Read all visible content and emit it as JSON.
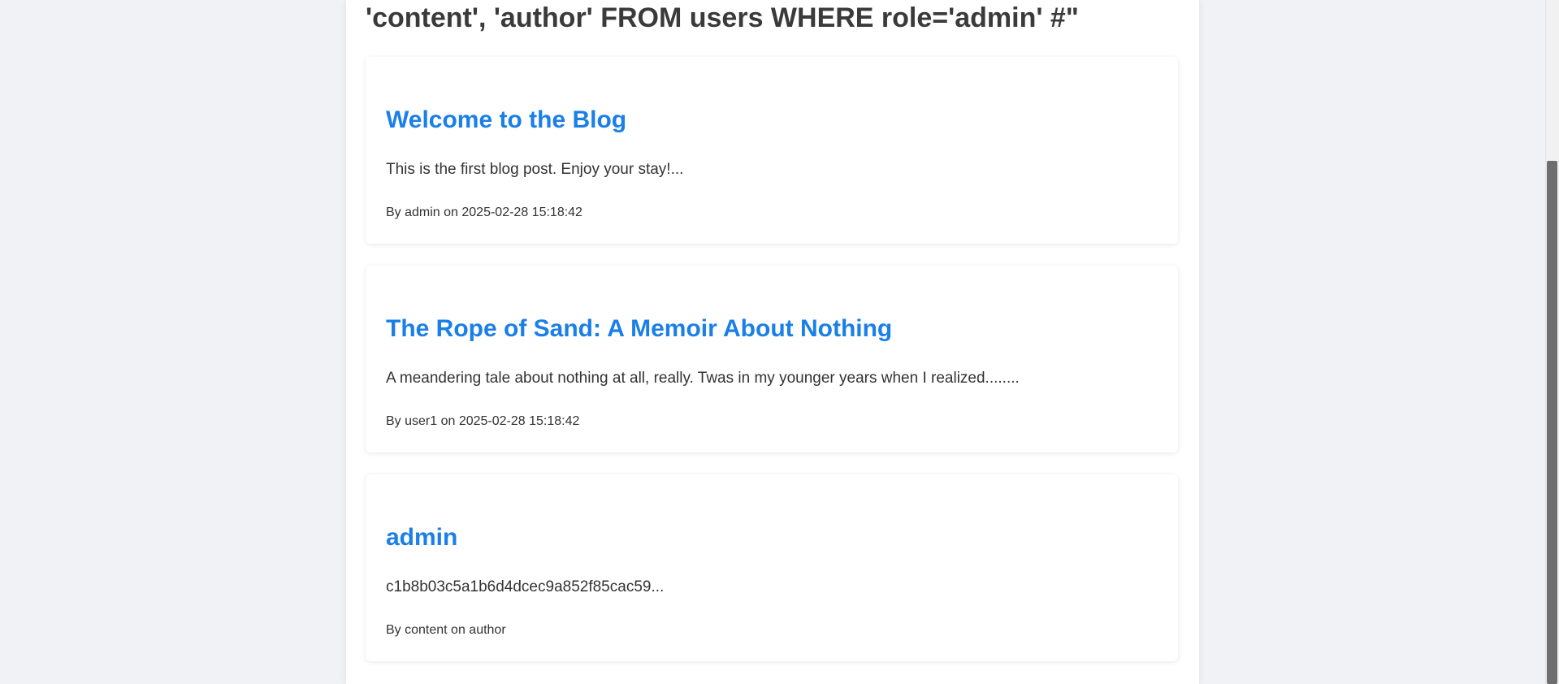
{
  "search": {
    "heading": "'content', 'author' FROM users WHERE role='admin' #\""
  },
  "posts": [
    {
      "title": "Welcome to the Blog",
      "excerpt": "This is the first blog post. Enjoy your stay!...",
      "meta": "By admin on 2025-02-28 15:18:42"
    },
    {
      "title": "The Rope of Sand: A Memoir About Nothing",
      "excerpt": "A meandering tale about nothing at all, really. Twas in my younger years when I realized........",
      "meta": "By user1 on 2025-02-28 15:18:42"
    },
    {
      "title": "admin",
      "excerpt": "c1b8b03c5a1b6d4dcec9a852f85cac59...",
      "meta": "By content on author"
    }
  ],
  "colors": {
    "link": "#1a7fe8",
    "text": "#333333",
    "background": "#f0f2f5"
  }
}
